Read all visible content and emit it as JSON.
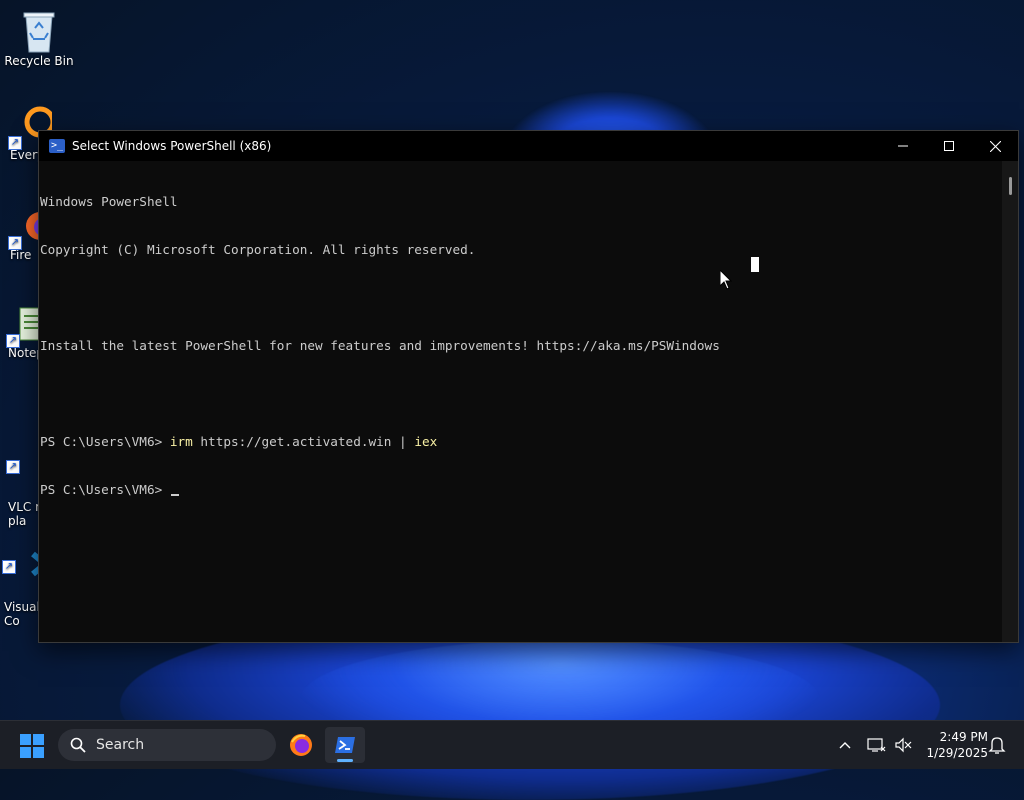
{
  "window": {
    "title": "Select Windows PowerShell (x86)",
    "controls": {
      "minimize": "—",
      "maximize": "□",
      "close": "✕"
    }
  },
  "console": {
    "lines": [
      "Windows PowerShell",
      "Copyright (C) Microsoft Corporation. All rights reserved.",
      "",
      "Install the latest PowerShell for new features and improvements! https://aka.ms/PSWindows",
      ""
    ],
    "prompt_1": "PS C:\\Users\\VM6> ",
    "command_1_cmd": "irm",
    "command_1_args": " https://get.activated.win | ",
    "command_1_pipe_cmd": "iex",
    "prompt_2": "PS C:\\Users\\VM6> "
  },
  "desktop": {
    "icons": [
      {
        "label": "Recycle Bin",
        "icon": "recycle-bin-icon"
      },
      {
        "label": "Every",
        "icon": "everything-icon"
      },
      {
        "label": "Fire",
        "icon": "firefox-icon"
      },
      {
        "label": "Notep",
        "icon": "notepad-icon"
      },
      {
        "label": "VLC m\npla",
        "icon": "vlc-icon"
      },
      {
        "label": "Visual\nCo",
        "icon": "vscode-icon"
      }
    ]
  },
  "taskbar": {
    "search_label": "Search",
    "apps": [
      {
        "name": "Firefox",
        "icon": "firefox-icon"
      },
      {
        "name": "Windows PowerShell",
        "icon": "powershell-icon",
        "active": true
      }
    ],
    "time": "2:49 PM",
    "date": "1/29/2025"
  },
  "colors": {
    "accent": "#3aa0ff",
    "console_bg": "#0c0c0c",
    "console_fg": "#cccccc",
    "command_color": "#f9f1a5"
  }
}
